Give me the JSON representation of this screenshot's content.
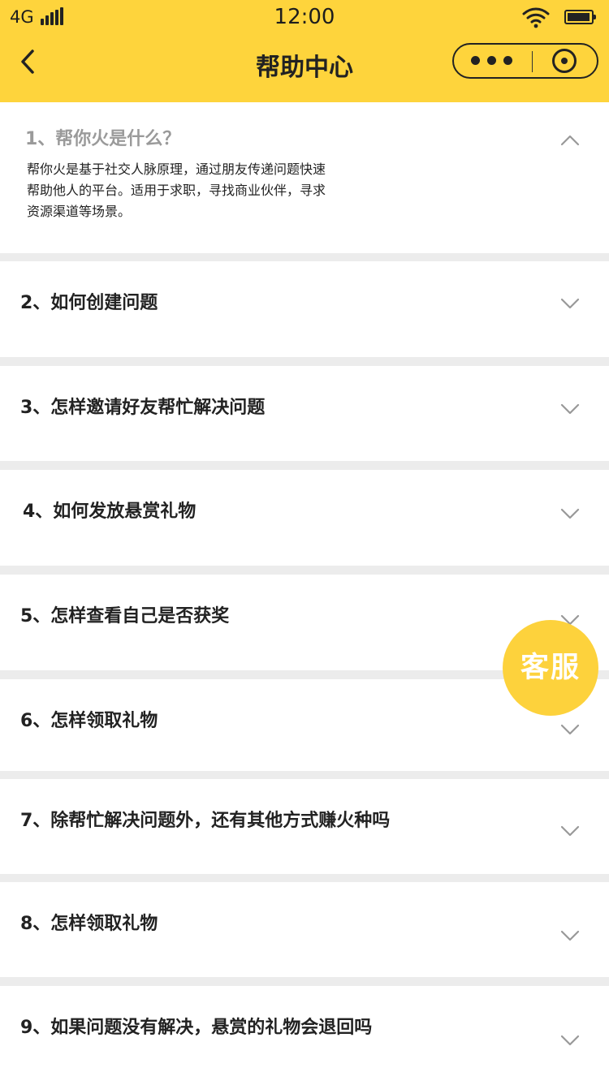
{
  "status_bar": {
    "carrier": "4G",
    "time": "12:00",
    "battery_icon": "battery-icon",
    "wifi_icon": "wifi-icon"
  },
  "nav": {
    "title": "帮助中心",
    "back_icon": "chevron-left-icon",
    "menu_icon": "more-dots-icon",
    "close_icon": "target-icon"
  },
  "faq": {
    "items": [
      {
        "question": "1、帮你火是什么？",
        "answer_lines": [
          "帮你火是基于社交人脉原理，通过朋友传递问题快速",
          "帮助他人的平台。适用于求职，寻找商业伙伴，寻求",
          "资源渠道等场景。"
        ],
        "expanded": true
      },
      {
        "question": "2、如何创建问题",
        "expanded": false
      },
      {
        "question": "3、怎样邀请好友帮忙解决问题",
        "expanded": false
      },
      {
        "question": "4、如何发放悬赏礼物",
        "expanded": false
      },
      {
        "question": "5、怎样查看自己是否获奖",
        "expanded": false
      },
      {
        "question": "6、怎样领取礼物",
        "expanded": false
      },
      {
        "question": "7、除帮忙解决问题外，还有其他方式赚火种吗",
        "expanded": false
      },
      {
        "question": "8、怎样领取礼物",
        "expanded": false
      },
      {
        "question": "9、如果问题没有解决，悬赏的礼物会退回吗",
        "expanded": false
      }
    ]
  },
  "floating_button": {
    "label": "客服"
  },
  "colors": {
    "accent": "#fed43c",
    "text_primary": "#222222",
    "text_muted": "#9a9a9a",
    "chevron": "#999999",
    "background": "#ececec",
    "card": "#ffffff"
  }
}
